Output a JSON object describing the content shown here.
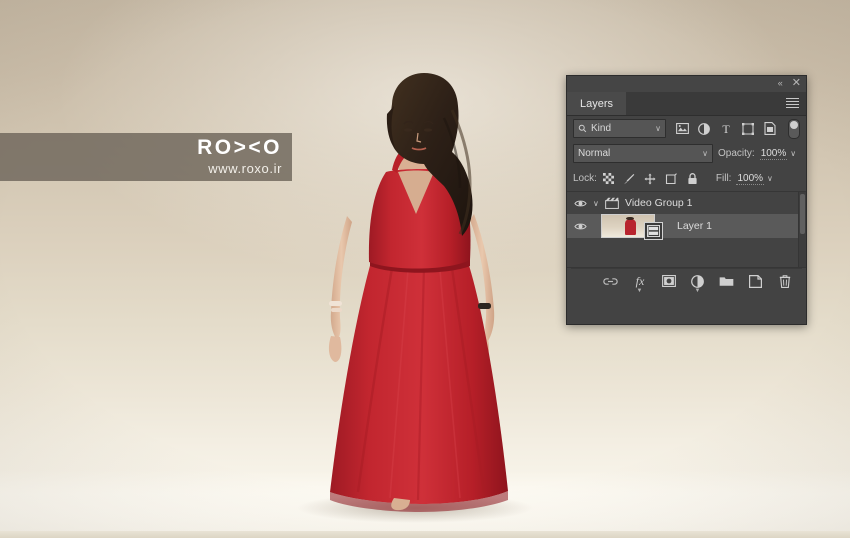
{
  "canvas": {
    "background_color": "#c9bca9",
    "photo_description": "studio photo of woman in long red dress on beige backdrop",
    "dress_color": "#c0242e",
    "hair_color": "#3a2a22"
  },
  "watermark": {
    "logo": "RO><O",
    "url": "www.roxo.ir",
    "bar_color": "#6e655a"
  },
  "panel": {
    "title": "Layers",
    "topbar": {
      "collapse_icon": "double-chevron-left-icon",
      "collapse_glyph": "«",
      "close_icon": "close-icon",
      "close_glyph": "✕"
    },
    "menu_icon": "panel-menu-icon",
    "filter": {
      "search_icon": "search-icon",
      "kind_label": "Kind",
      "chevron": "∨",
      "icons": [
        {
          "name": "filter-pixel-icon",
          "title": "Pixel layers"
        },
        {
          "name": "filter-adjustment-icon",
          "title": "Adjustment layers"
        },
        {
          "name": "filter-type-icon",
          "title": "Type layers",
          "glyph": "T"
        },
        {
          "name": "filter-shape-icon",
          "title": "Shape layers"
        },
        {
          "name": "filter-smart-object-icon",
          "title": "Smart objects"
        }
      ],
      "toggle_name": "filter-enable-toggle"
    },
    "blend": {
      "mode": "Normal",
      "chevron": "∨",
      "opacity_label": "Opacity:",
      "opacity_value": "100%"
    },
    "lock": {
      "label": "Lock:",
      "icons": [
        {
          "name": "lock-transparency-icon"
        },
        {
          "name": "lock-image-pixels-icon"
        },
        {
          "name": "lock-position-icon"
        },
        {
          "name": "lock-artboard-icon"
        },
        {
          "name": "lock-all-icon"
        }
      ],
      "fill_label": "Fill:",
      "fill_value": "100%"
    },
    "layers": [
      {
        "name": "Video Group 1",
        "type": "group",
        "visible": true,
        "expanded": true,
        "selected": false,
        "icon": "video-group-icon"
      },
      {
        "name": "Layer 1",
        "type": "video",
        "visible": true,
        "selected": true,
        "thumbnail": "video-frame-thumbnail",
        "badge": "film-strip-icon"
      }
    ],
    "footer_buttons": [
      {
        "name": "link-layers-button",
        "title": "Link layers"
      },
      {
        "name": "layer-style-button",
        "title": "Add a layer style",
        "label": "fx",
        "has_caret": true
      },
      {
        "name": "add-layer-mask-button",
        "title": "Add layer mask"
      },
      {
        "name": "adjustment-layer-button",
        "title": "Create new fill or adjustment layer",
        "has_caret": true
      },
      {
        "name": "new-group-button",
        "title": "Create a new group"
      },
      {
        "name": "new-layer-button",
        "title": "Create a new layer"
      },
      {
        "name": "delete-layer-button",
        "title": "Delete layer"
      }
    ]
  }
}
